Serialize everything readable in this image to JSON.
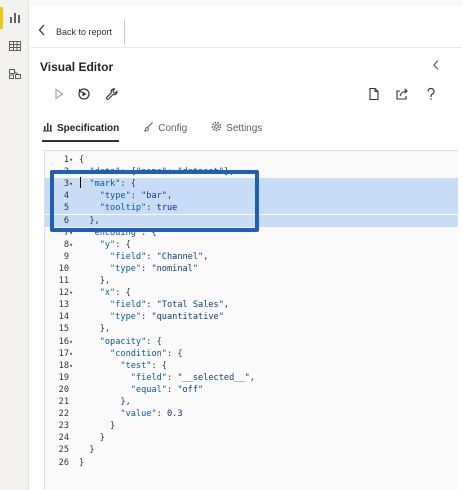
{
  "rail": {
    "items": [
      {
        "name": "report-view-icon",
        "active": true
      },
      {
        "name": "table-view-icon",
        "active": false
      },
      {
        "name": "model-view-icon",
        "active": false
      }
    ]
  },
  "topbar": {
    "back_label": "Back to report"
  },
  "editor": {
    "title": "Visual Editor",
    "tabs": [
      {
        "label": "Specification",
        "icon": "chart-icon",
        "active": true
      },
      {
        "label": "Config",
        "icon": "brush-icon",
        "active": false
      },
      {
        "label": "Settings",
        "icon": "gear-icon",
        "active": false
      }
    ],
    "toolbar": [
      "run-icon",
      "auto-apply-icon",
      "wrench-icon",
      "new-file-icon",
      "export-icon",
      "help-icon"
    ]
  },
  "code": {
    "lines": [
      {
        "n": "1",
        "fold": "▾",
        "text": "{",
        "sel": false
      },
      {
        "n": "2",
        "fold": "",
        "text": "  \"data\": {\"name\": \"dataset\"},",
        "sel": false
      },
      {
        "n": "3",
        "fold": "▾",
        "text": "  \"mark\": {",
        "sel": true
      },
      {
        "n": "4",
        "fold": "",
        "text": "    \"type\": \"bar\",",
        "sel": true
      },
      {
        "n": "5",
        "fold": "",
        "text": "    \"tooltip\": true",
        "sel": true
      },
      {
        "n": "6",
        "fold": "",
        "text": "  },",
        "sel": true
      },
      {
        "n": "7",
        "fold": "▾",
        "text": "  \"encoding\": {",
        "sel": false
      },
      {
        "n": "8",
        "fold": "▾",
        "text": "    \"y\": {",
        "sel": false
      },
      {
        "n": "9",
        "fold": "",
        "text": "      \"field\": \"Channel\",",
        "sel": false
      },
      {
        "n": "10",
        "fold": "",
        "text": "      \"type\": \"nominal\"",
        "sel": false
      },
      {
        "n": "11",
        "fold": "",
        "text": "    },",
        "sel": false
      },
      {
        "n": "12",
        "fold": "▾",
        "text": "    \"x\": {",
        "sel": false
      },
      {
        "n": "13",
        "fold": "",
        "text": "      \"field\": \"Total Sales\",",
        "sel": false
      },
      {
        "n": "14",
        "fold": "",
        "text": "      \"type\": \"quantitative\"",
        "sel": false
      },
      {
        "n": "15",
        "fold": "",
        "text": "    },",
        "sel": false
      },
      {
        "n": "16",
        "fold": "▾",
        "text": "    \"opacity\": {",
        "sel": false
      },
      {
        "n": "17",
        "fold": "▾",
        "text": "      \"condition\": {",
        "sel": false
      },
      {
        "n": "18",
        "fold": "▾",
        "text": "        \"test\": {",
        "sel": false
      },
      {
        "n": "19",
        "fold": "",
        "text": "          \"field\": \"__selected__\",",
        "sel": false
      },
      {
        "n": "20",
        "fold": "",
        "text": "          \"equal\": \"off\"",
        "sel": false
      },
      {
        "n": "21",
        "fold": "",
        "text": "        },",
        "sel": false
      },
      {
        "n": "22",
        "fold": "",
        "text": "        \"value\": 0.3",
        "sel": false
      },
      {
        "n": "23",
        "fold": "",
        "text": "      }",
        "sel": false
      },
      {
        "n": "24",
        "fold": "",
        "text": "    }",
        "sel": false
      },
      {
        "n": "25",
        "fold": "",
        "text": "  }",
        "sel": false
      },
      {
        "n": "26",
        "fold": "",
        "text": "}",
        "sel": false
      }
    ]
  }
}
